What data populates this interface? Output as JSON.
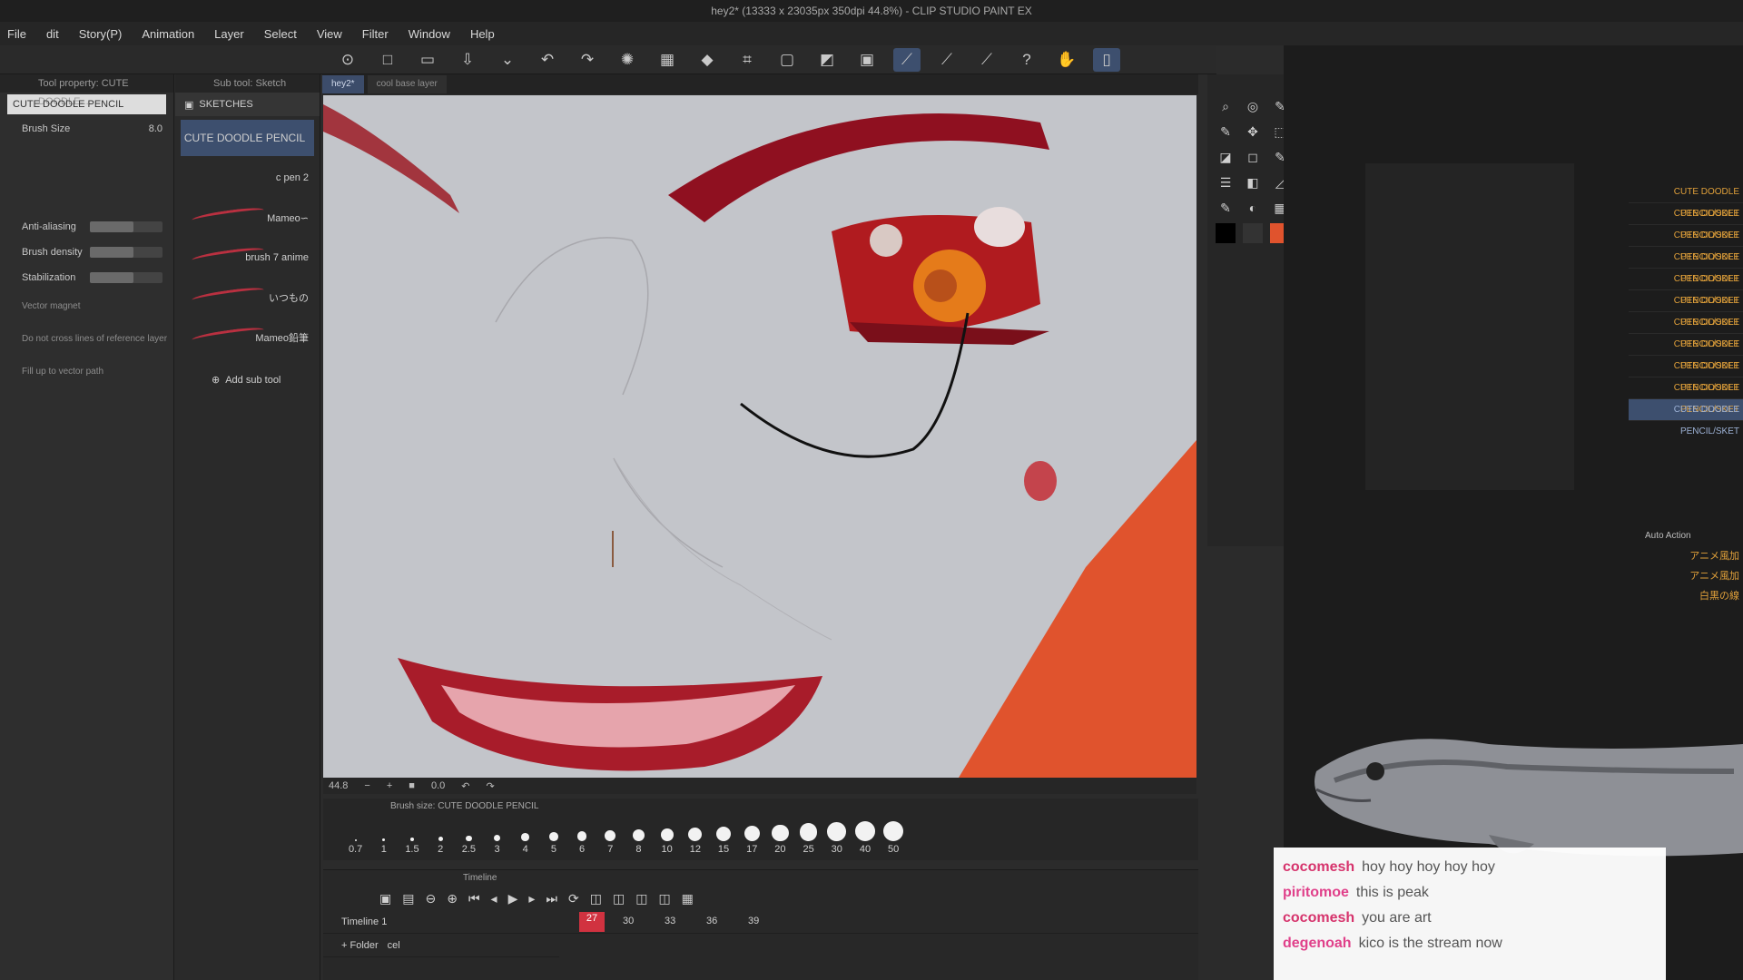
{
  "window": {
    "title": "hey2* (13333 x 23035px 350dpi 44.8%) - CLIP STUDIO PAINT EX"
  },
  "menu": [
    "File",
    "dit",
    "Story(P)",
    "Animation",
    "Layer",
    "Select",
    "View",
    "Filter",
    "Window",
    "Help"
  ],
  "command_bar": {
    "icons": [
      "clip-icon",
      "new-icon",
      "open-icon",
      "save-icon",
      "dropdown-icon",
      "undo-icon",
      "redo-icon",
      "loading-icon",
      "fill-icon",
      "bucket-icon",
      "crop-icon",
      "pen-icon",
      "brush-icon",
      "ruler-icon",
      "help-icon",
      "hand-icon",
      "layout-icon"
    ]
  },
  "tool_property": {
    "tab": "Tool property: CUTE DOODLE...",
    "tool_name": "CUTE DOODLE PENCIL",
    "brush_size_label": "Brush Size",
    "brush_size_value": "8.0",
    "anti_aliasing": "Anti-aliasing",
    "brush_density": "Brush density",
    "stabilization": "Stabilization",
    "vector_magnet": "Vector magnet",
    "no_cross_lines": "Do not cross lines of reference layer",
    "fill_vector": "Fill up to vector path"
  },
  "sub_tool": {
    "tab": "Sub tool: Sketch",
    "group": "SKETCHES",
    "items": [
      {
        "label": "CUTE DOODLE PENCIL",
        "selected": true
      },
      {
        "label": "c pen 2"
      },
      {
        "label": "Mameo∽"
      },
      {
        "label": "brush 7 anime"
      },
      {
        "label": "いつもの"
      },
      {
        "label": "Mameo鉛筆"
      }
    ],
    "add_label": "Add sub tool"
  },
  "canvas_tabs": [
    {
      "label": "hey2*",
      "active": true
    },
    {
      "label": "cool base layer"
    }
  ],
  "canvas_status": {
    "zoom": "44.8",
    "angle": "0.0"
  },
  "brush_size_panel": {
    "title": "Brush size: CUTE DOODLE PENCIL",
    "sizes": [
      "0.7",
      "1",
      "1.5",
      "2",
      "2.5",
      "3",
      "4",
      "5",
      "6",
      "7",
      "8",
      "10",
      "12",
      "15",
      "17",
      "20",
      "25",
      "30",
      "40",
      "50"
    ]
  },
  "timeline": {
    "title": "Timeline",
    "name": "Timeline 1",
    "current_frame": "27",
    "frame_labels": [
      "30",
      "33",
      "36",
      "39"
    ],
    "folder_row": "Folder",
    "cel_label": "cel"
  },
  "auto_action": {
    "title": "Auto Action",
    "items": [
      "アニメ風加",
      "アニメ風加",
      "白黒の線"
    ]
  },
  "subtool_list": [
    "CUTE DOODLE PENCIL/SKET",
    "CUTE DOODLE PENCIL/SKET",
    "CUTE DOODLE PENCIL/SKET",
    "CUTE DOODLE PENCIL/SKET",
    "CUTE DOODLE PENCIL/SKET",
    "CUTE DOODLE PENCIL/SKET",
    "CUTE DOODLE PENCIL/SKET",
    "CUTE DOODLE PENCIL/SKET",
    "CUTE DOODLE PENCIL/SKET",
    "CUTE DOODLE PENCIL/SKET",
    "CUTE DOODLE PENCIL/SKET"
  ],
  "chat": [
    {
      "user": "cocomesh",
      "message": "hoy hoy hoy hoy hoy"
    },
    {
      "user": "piritomoe",
      "message": "this is peak"
    },
    {
      "user": "cocomesh",
      "message": "you are art"
    },
    {
      "user": "degenoah",
      "message": "kico is the stream now"
    }
  ],
  "colors": {
    "accent": "#3d4f6e",
    "red": "#d13240",
    "eye": "#8f1020",
    "chat_name": "#d6336c"
  }
}
